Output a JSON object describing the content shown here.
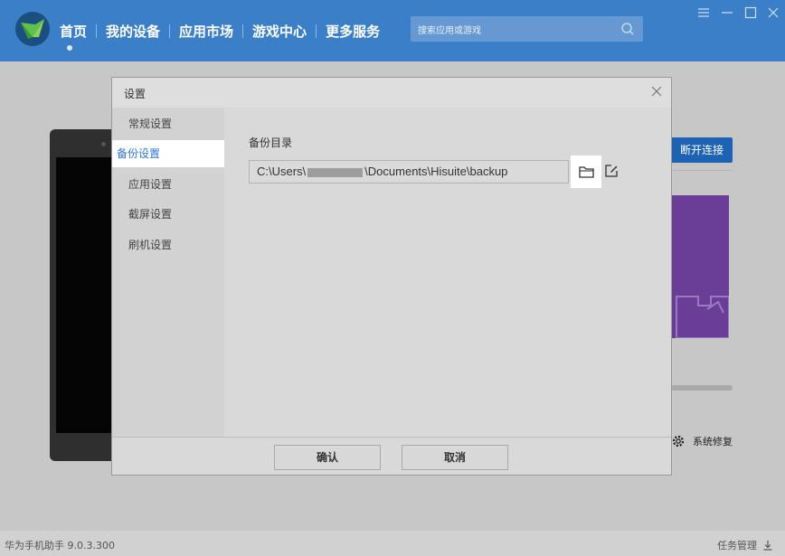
{
  "app": {
    "nav": [
      "首页",
      "我的设备",
      "应用市场",
      "游戏中心",
      "更多服务"
    ],
    "search_placeholder": "搜索应用或游戏"
  },
  "background": {
    "disconnect_label": "断开连接",
    "repair_label": "系统修复"
  },
  "status_bar": {
    "left": "华为手机助手 9.0.3.300",
    "right": "任务管理"
  },
  "dialog": {
    "title": "设置",
    "sidebar": [
      "常规设置",
      "备份设置",
      "应用设置",
      "截屏设置",
      "刷机设置"
    ],
    "active_index": 1,
    "section_label": "备份目录",
    "path_prefix": "C:\\Users\\",
    "path_suffix": "\\Documents\\Hisuite\\backup",
    "confirm_label": "确认",
    "cancel_label": "取消"
  },
  "colors": {
    "topbar": "#3a7fc8",
    "active_text": "#2b79d6",
    "banner": "#6a3e96"
  }
}
